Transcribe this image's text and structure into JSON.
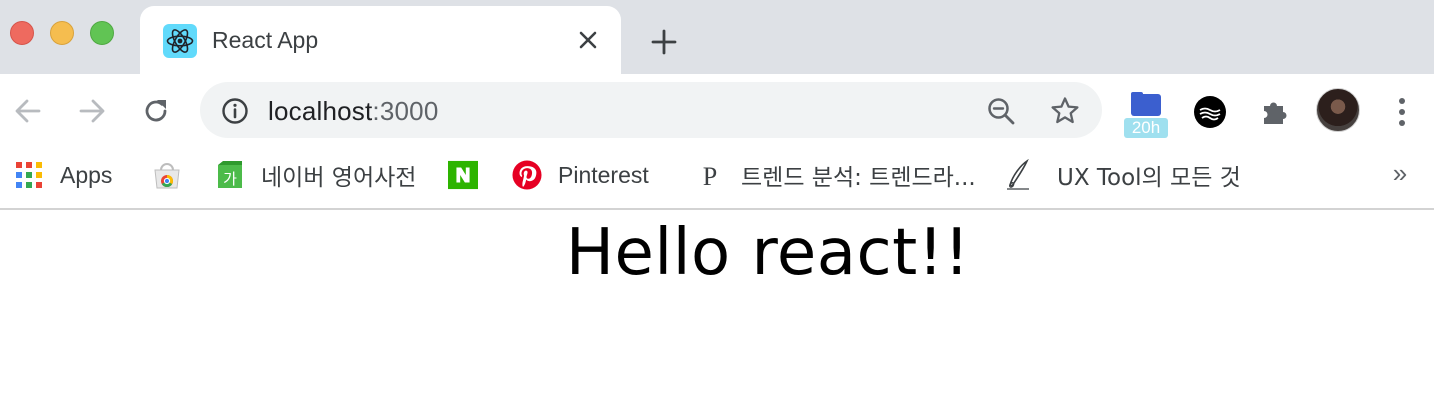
{
  "window": {
    "controls": [
      "close",
      "minimize",
      "maximize"
    ]
  },
  "tab": {
    "title": "React App",
    "favicon": "react-logo-icon"
  },
  "toolbar": {
    "url_host": "localhost",
    "url_port": ":3000"
  },
  "extensions": {
    "badge": "20h"
  },
  "bookmarks": {
    "items": [
      {
        "label": "Apps",
        "icon": "apps-grid-icon"
      },
      {
        "label": "",
        "icon": "chrome-web-store-icon"
      },
      {
        "label": "네이버 영어사전",
        "icon": "naver-dictionary-icon"
      },
      {
        "label": "",
        "icon": "naver-icon"
      },
      {
        "label": "Pinterest",
        "icon": "pinterest-icon"
      },
      {
        "label": "트렌드 분석: 트렌드라...",
        "icon": "p-letter-icon"
      },
      {
        "label": "UX Tool의 모든 것",
        "icon": "pen-nib-icon"
      }
    ],
    "more": "»"
  },
  "page": {
    "heading": "Hello react!!"
  },
  "colors": {
    "tabstrip": "#dee1e6",
    "omnibox": "#f1f3f4",
    "react_blue": "#61dafb",
    "pinterest_red": "#e60023",
    "naver_green": "#03c75a"
  }
}
